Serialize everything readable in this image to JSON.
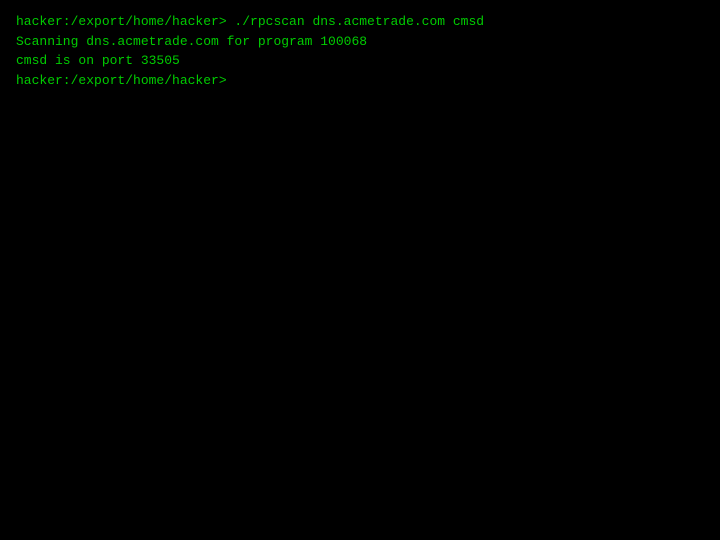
{
  "terminal": {
    "background": "#000000",
    "text_color": "#00cc00",
    "lines": [
      {
        "id": "command-line",
        "text": "hacker:/export/home/hacker> ./rpcscan dns.acmetrade.com cmsd"
      },
      {
        "id": "scanning-line",
        "text": "Scanning dns.acmetrade.com for program 100068"
      },
      {
        "id": "port-line",
        "text": "cmsd is on port 33505"
      },
      {
        "id": "prompt-line",
        "text": "hacker:/export/home/hacker>"
      }
    ]
  }
}
